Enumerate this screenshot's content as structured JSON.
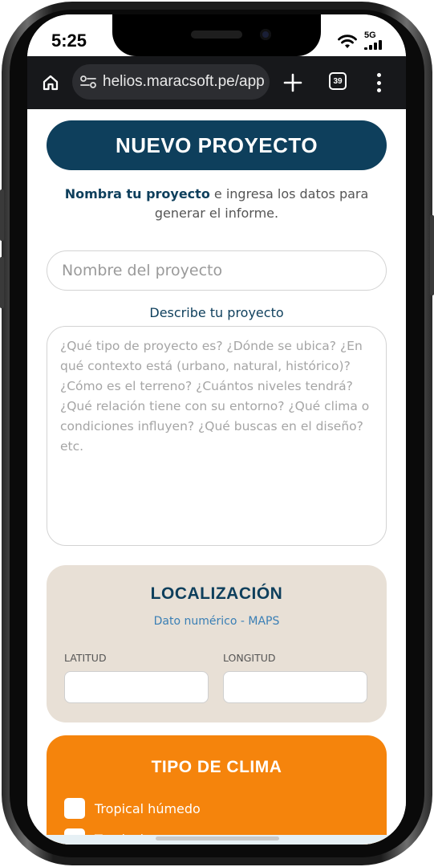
{
  "status_bar": {
    "time": "5:25",
    "network": "5G",
    "icons": [
      "wifi-icon",
      "signal-icon"
    ]
  },
  "browser": {
    "url": "helios.maracsoft.pe/app",
    "tab_count": "39",
    "icons": [
      "home-icon",
      "site-settings-icon",
      "new-tab-icon",
      "tabs-icon",
      "more-menu-icon"
    ]
  },
  "page": {
    "title": "NUEVO PROYECTO",
    "intro_bold": "Nombra tu proyecto",
    "intro_rest": " e ingresa los datos para generar el informe.",
    "name_placeholder": "Nombre del proyecto",
    "description_label": "Describe tu proyecto",
    "description_placeholder": "¿Qué tipo de proyecto es? ¿Dónde se ubica? ¿En qué contexto está (urbano, natural, histórico)? ¿Cómo es el terreno? ¿Cuántos niveles tendrá? ¿Qué relación tiene con su entorno? ¿Qué clima o condiciones influyen? ¿Qué buscas en el diseño? etc.",
    "location": {
      "title": "LOCALIZACIÓN",
      "subtitle": "Dato numérico - MAPS",
      "latitude_label": "LATITUD",
      "longitude_label": "LONGITUD"
    },
    "climate": {
      "title": "TIPO DE CLIMA",
      "options": [
        "Tropical húmedo",
        "Tropical"
      ]
    }
  },
  "colors": {
    "primary": "#0e3f5c",
    "location_card": "#e8e0d6",
    "climate_card": "#f5840c",
    "browser_bar": "#17181b"
  }
}
